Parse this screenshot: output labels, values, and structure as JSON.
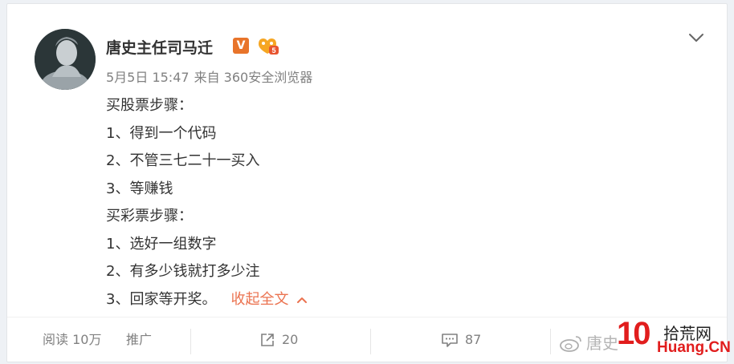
{
  "post": {
    "user_name": "唐史主任司马迁",
    "date": "5月5日 15:47",
    "source": "来自 360安全浏览器",
    "lines": [
      "买股票步骤：",
      "1、得到一个代码",
      "2、不管三七二十一买入",
      "3、等赚钱",
      "买彩票步骤：",
      "1、选好一组数字",
      "2、有多少钱就打多少注",
      "3、回家等开奖。"
    ],
    "collapse_label": "收起全文"
  },
  "footer": {
    "reads": "阅读 10万",
    "promote": "推广",
    "repost_count": "20",
    "comment_count": "87"
  },
  "watermark": {
    "weibo_text": "唐史",
    "logo_number": "10",
    "logo_cn": "拾荒网",
    "logo_domain": "Huang.CN"
  },
  "colors": {
    "accent": "#eb7350",
    "vip": "#e8742a",
    "text": "#333333",
    "muted": "#808080"
  },
  "icons": [
    "avatar-image",
    "vip-v-icon",
    "level-badge-icon",
    "chevron-down-icon",
    "repost-icon",
    "comment-icon",
    "weibo-logo-icon"
  ]
}
